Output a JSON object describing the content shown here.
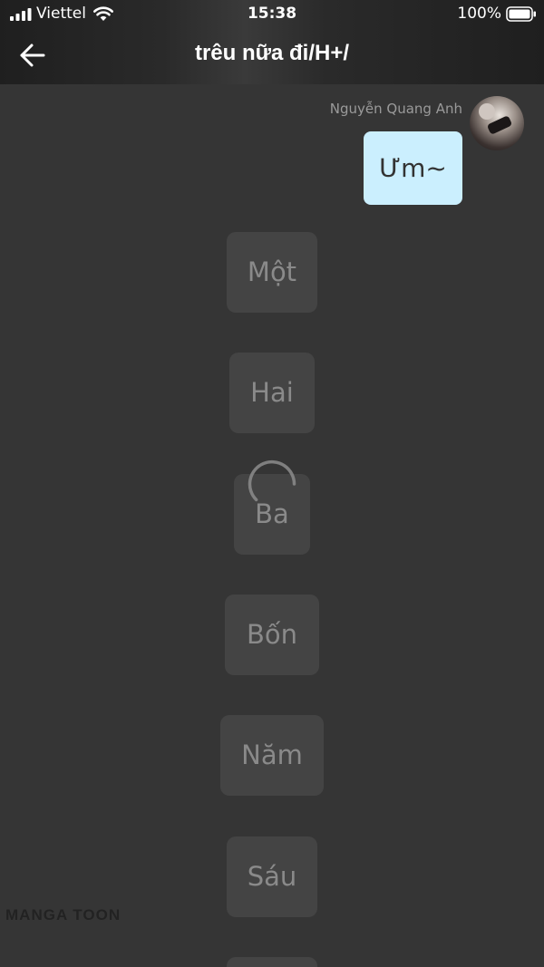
{
  "status_bar": {
    "carrier": "Viettel",
    "time": "15:38",
    "battery": "100%"
  },
  "header": {
    "title": "trêu nữa đi/H+/"
  },
  "message": {
    "sender": "Nguyễn Quang Anh",
    "text": "Ưm~"
  },
  "cards": [
    "Một",
    "Hai",
    "Ba",
    "Bốn",
    "Năm",
    "Sáu"
  ],
  "watermark": "MANGA TOON",
  "colors": {
    "background": "#353535",
    "bubble": "#cbeffe",
    "card": "#444444",
    "card_text": "#8a8a8a"
  }
}
